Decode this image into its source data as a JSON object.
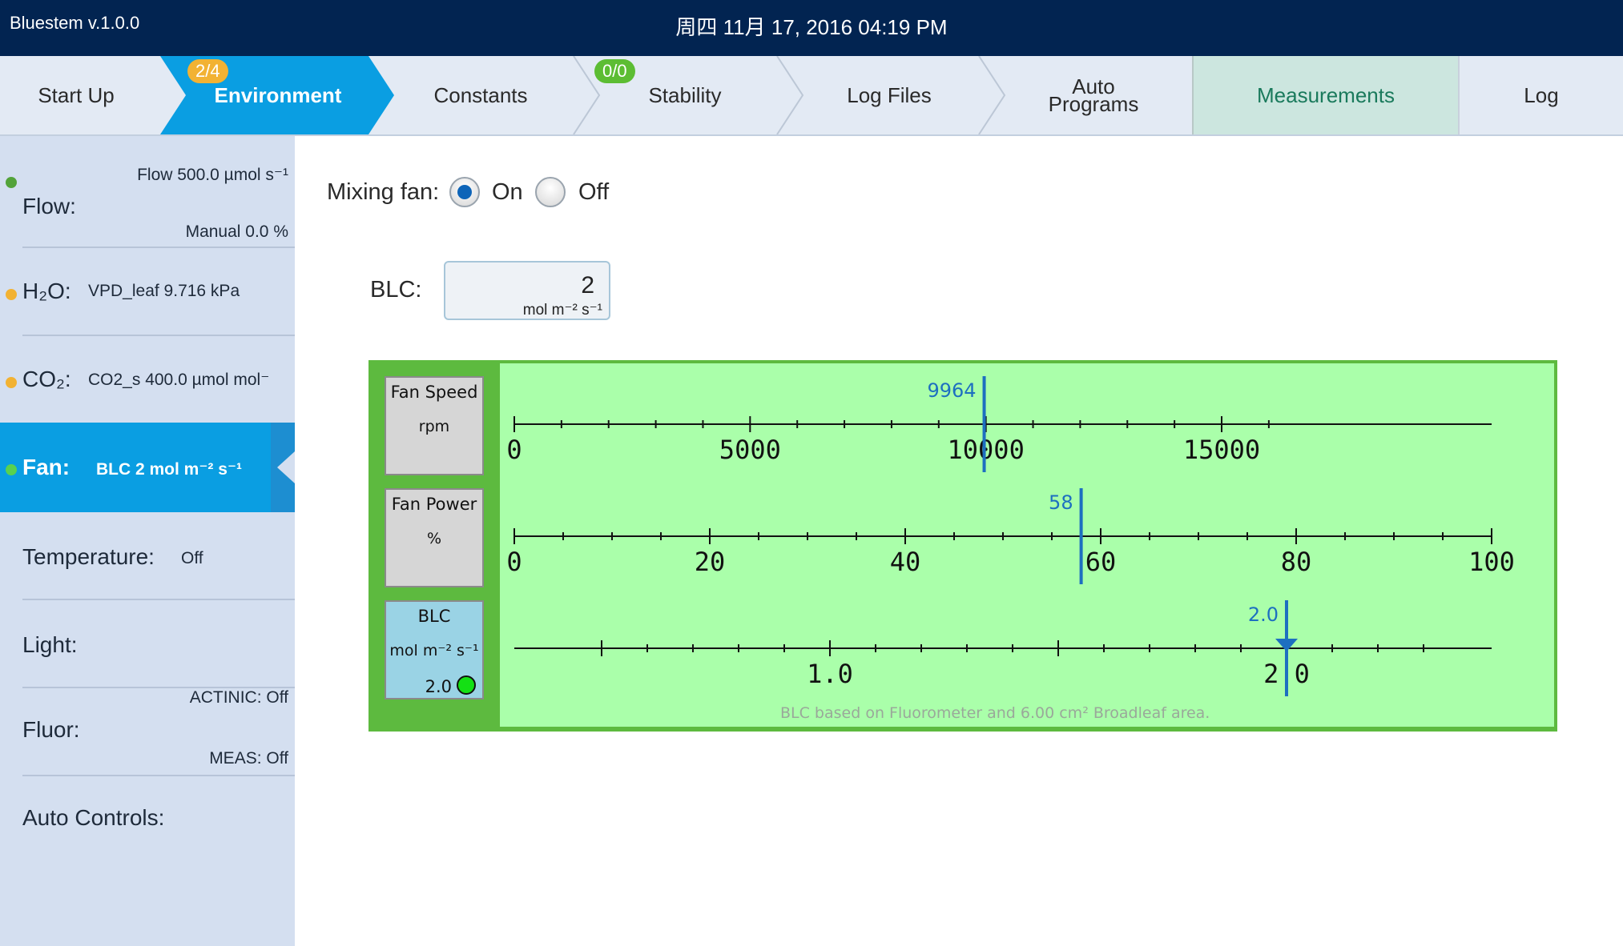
{
  "titlebar": {
    "app": "Bluestem v.1.0.0",
    "clock": "周四 11月 17, 2016 04:19 PM"
  },
  "tabs": [
    {
      "label": "Start Up"
    },
    {
      "label": "Environment",
      "badge": "2/4"
    },
    {
      "label": "Constants"
    },
    {
      "label": "Stability",
      "badge": "0/0"
    },
    {
      "label": "Log Files"
    },
    {
      "label": "Auto\nPrograms"
    },
    {
      "label": "Measurements"
    },
    {
      "label": "Log"
    }
  ],
  "colors": {
    "accent": "#0a9ee2",
    "titlebar": "#022451",
    "badge_orange": "#f2b233",
    "badge_green": "#5cbd33",
    "status_green": "#53a33a",
    "status_orange": "#f2b233",
    "status_bright_green": "#59d14f",
    "panel_green": "#5dba3f",
    "panel_light": "#aaffaa",
    "marker_blue": "#1d6fc0"
  },
  "sidebar": {
    "flow": {
      "label": "Flow:",
      "line1": "Flow 500.0 µmol s⁻¹",
      "line2": "Manual 0.0 %"
    },
    "h2o": {
      "label": "H₂O:",
      "value": "VPD_leaf 9.716 kPa"
    },
    "co2": {
      "label": "CO₂:",
      "value": "CO2_s 400.0 µmol mol⁻"
    },
    "fan": {
      "label": "Fan:",
      "value": "BLC 2 mol m⁻² s⁻¹"
    },
    "temperature": {
      "label": "Temperature:",
      "value": "Off"
    },
    "light": {
      "label": "Light:"
    },
    "fluor": {
      "label": "Fluor:",
      "line1": "ACTINIC: Off",
      "line2": "MEAS: Off"
    },
    "auto": {
      "label": "Auto Controls:"
    }
  },
  "main": {
    "mixing_fan_label": "Mixing fan:",
    "on_label": "On",
    "off_label": "Off",
    "blc_label": "BLC:",
    "blc_value": "2",
    "blc_unit": "mol m⁻² s⁻¹",
    "scales": [
      {
        "title": "Fan Speed",
        "unit": "rpm",
        "min": 0,
        "max": 16000,
        "major": 5000,
        "minor": 1000,
        "tick_labels": [
          "0",
          "5000",
          "10000",
          "15000"
        ],
        "value": 9964,
        "value_label": "9964"
      },
      {
        "title": "Fan Power",
        "unit": "%",
        "min": 0,
        "max": 100,
        "major": 20,
        "minor": 5,
        "tick_labels": [
          "0",
          "20",
          "40",
          "60",
          "80",
          "100"
        ],
        "value": 58,
        "value_label": "58"
      },
      {
        "title": "BLC",
        "unit": "mol m⁻² s⁻¹",
        "current": "2.0",
        "min": 0.5,
        "max": 2.3,
        "major": 0.5,
        "minor": 0.1,
        "tick_labels": [
          "1.0",
          "2.0"
        ],
        "value": 2.0,
        "value_label": "2.0"
      }
    ],
    "note": "BLC based on  Fluorometer and 6.00 cm²  Broadleaf area."
  }
}
